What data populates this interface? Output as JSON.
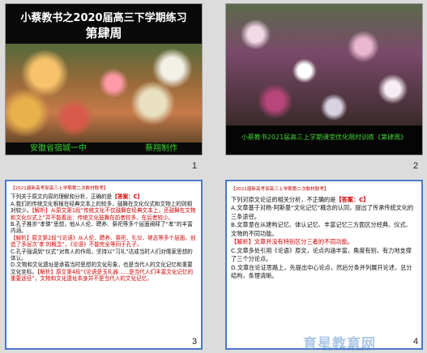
{
  "slide1": {
    "title": "小蔡教书之2020届高三下学期练习",
    "subtitle": "第肆周",
    "footer_left": "安徽省宿城一中",
    "footer_right": "蔡翔制作",
    "number": "1"
  },
  "slide2": {
    "caption": "小蔡教书2021届高三上学期课堂优化限时训练《第肆周》",
    "number": "2"
  },
  "slide3": {
    "header": "【2021届新高考部高三上学期第二次数材联考】",
    "q_text": "下列关于原文内容的理解和分析，正确的是",
    "q_answer": "【答案：C】",
    "a1": "A.我们的传统文化根植在经典文本上的较多，鼓舞在文化仪式和文物上的则相对较少。",
    "a1_note": "【解析】从原文第1段“传统文化不仅鼓舞在经典文本上，还鼓舞在文物和文化仪式上”并不能看出：传统文化鼓舞在前者较多，在后者较少。",
    "b1": "B.孔子推崇“孝悌”思想，他从人伦、聘养、祭祀等多个层面阐释了“孝”的丰富内涵。",
    "b1_note": "【解析】原文第2段“《论语》从人伦、聘养、祭祀、礼仪、继志等多个层面，创造了多层次‘孝’的概念”，《论语》不能完全等同于孔子。",
    "c1": "C.孔子强调到“仪式”对育人的作用，坚持以“习礼”达成当时人们对儒家思想的体认。",
    "d1": "D.文物和文化遗址是承载当时思想的文化形象，也是当代人的文化记忆和重要文化坐标。",
    "d1_note": "【解析】原文第4段“《论语是玉礼器……是当代人们丰富文化记忆的重要途径”，文物和文化遗址本身并不是当代人的文化记忆。",
    "number": "3"
  },
  "slide4": {
    "header": "【2021届新高考部高三上学期第二次数材联考】",
    "q_text": "下列对原文论证的相关分析，不正确的是",
    "q_answer": "【答案：C】",
    "a1": "A.文章基于对杨·阿斯曼“文化记忆”概念的认同，提出了传承传统文化的三条途径。",
    "b1": "B.文章意在从建构记忆、体认记忆、丰富记忆三方面区分经典、仪式、文物的不同功能。",
    "b1_note": "【解析】文章并没有特别区分三者的不同功能。",
    "c1": "C.文章多处引用《论语》原文，论点内涵丰富，角度有别，有力地支撑了三个分论点。",
    "d1": "D.文章在论证思路上，先提出中心论点，然后分条并列展开论述，总分结构，条理清晰。",
    "number": "4"
  },
  "watermark": {
    "brand": "育星教育网",
    "url": "www.ht88.com"
  }
}
